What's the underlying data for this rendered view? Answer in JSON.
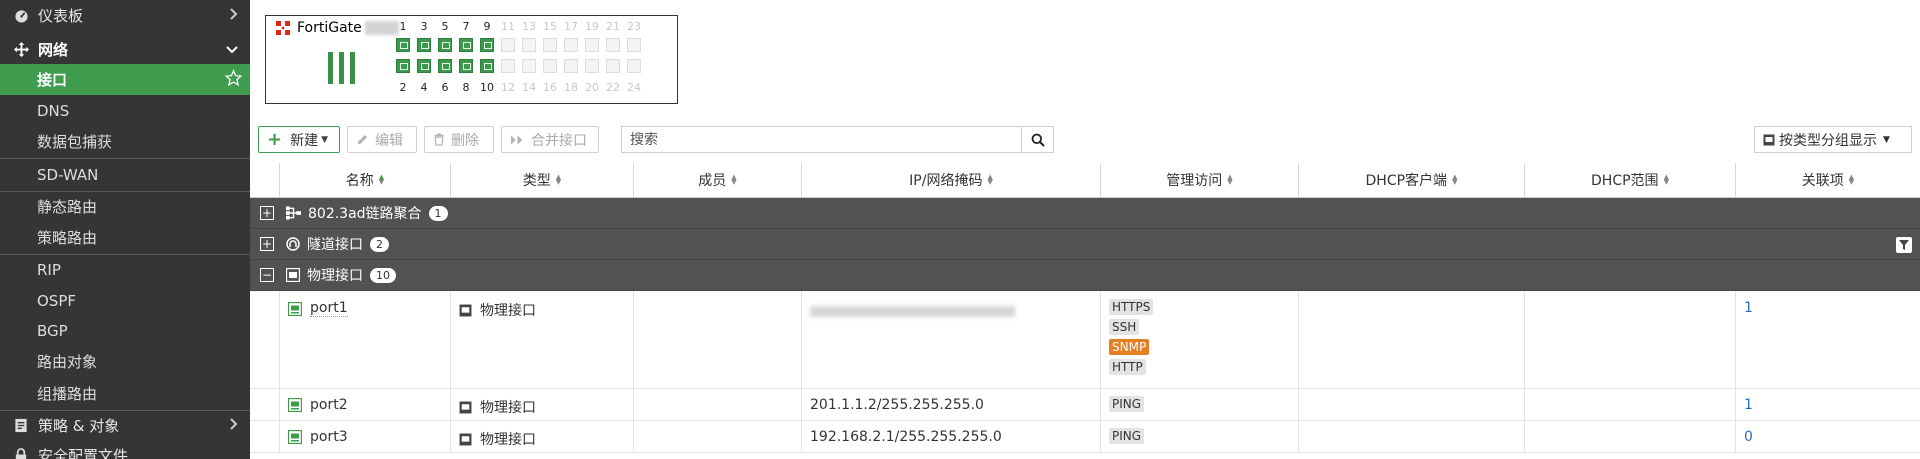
{
  "sidebar": {
    "dashboard": "仪表板",
    "network": "网络",
    "items": [
      "接口",
      "DNS",
      "数据包捕获",
      "SD-WAN",
      "静态路由",
      "策略路由",
      "RIP",
      "OSPF",
      "BGP",
      "路由对象",
      "组播路由"
    ],
    "policy_objects": "策略 & 对象",
    "security_profiles": "安全配置文件"
  },
  "device": {
    "brand": "FortiGate",
    "top_ports": [
      "1",
      "3",
      "5",
      "7",
      "9",
      "11",
      "13",
      "15",
      "17",
      "19",
      "21",
      "23"
    ],
    "bottom_ports": [
      "2",
      "4",
      "6",
      "8",
      "10",
      "12",
      "14",
      "16",
      "18",
      "20",
      "22",
      "24"
    ],
    "active_ports": 5
  },
  "toolbar": {
    "new_label": "新建",
    "edit_label": "编辑",
    "delete_label": "删除",
    "merge_label": "合并接口",
    "search_placeholder": "搜索",
    "group_by_label": "按类型分组显示"
  },
  "table": {
    "columns": [
      "名称",
      "类型",
      "成员",
      "IP/网络掩码",
      "管理访问",
      "DHCP客户端",
      "DHCP范围",
      "关联项"
    ],
    "groups": [
      {
        "label": "802.3ad链路聚合",
        "count": "1"
      },
      {
        "label": "隧道接口",
        "count": "2"
      },
      {
        "label": "物理接口",
        "count": "10"
      }
    ],
    "rows": [
      {
        "name": "port1",
        "type": "物理接口",
        "ip": "",
        "access": [
          "HTTPS",
          "SSH",
          "SNMP",
          "HTTP"
        ],
        "refs": "1"
      },
      {
        "name": "port2",
        "type": "物理接口",
        "ip": "201.1.1.2/255.255.255.0",
        "access": [
          "PING"
        ],
        "refs": "1"
      },
      {
        "name": "port3",
        "type": "物理接口",
        "ip": "192.168.2.1/255.255.255.0",
        "access": [
          "PING"
        ],
        "refs": "0"
      }
    ]
  },
  "colors": {
    "sidebar_bg": "#353535",
    "accent_green": "#3f9c4f",
    "group_row_bg": "#525252",
    "warn_tag": "#e67e22",
    "link_blue": "#2a6ebb"
  }
}
